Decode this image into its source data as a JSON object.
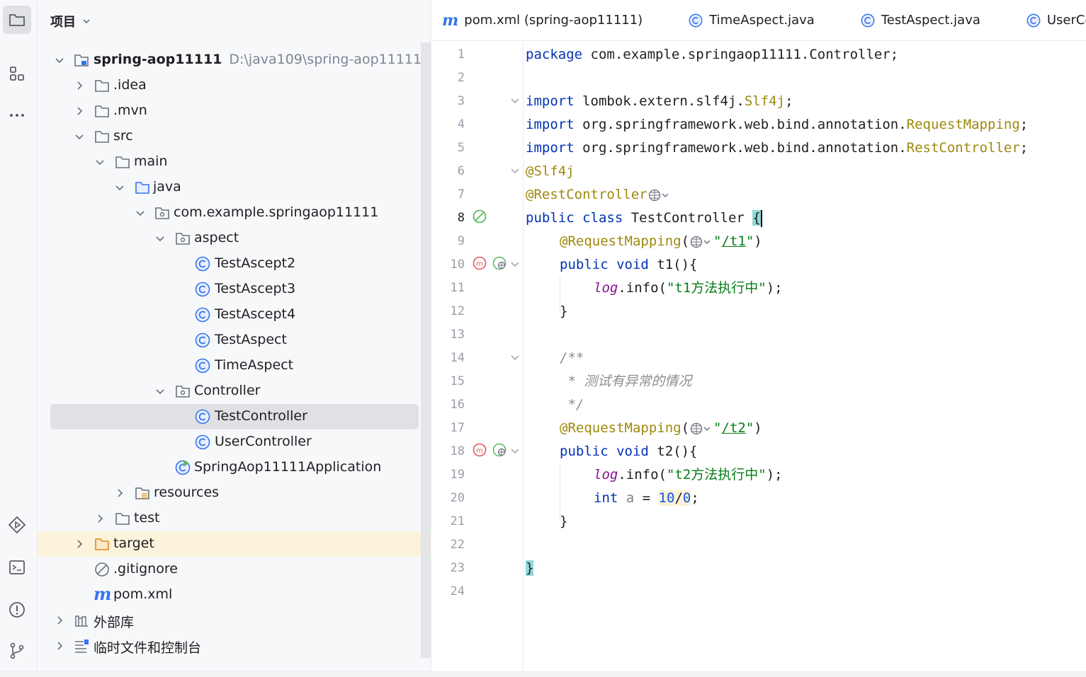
{
  "sidebar": {
    "tools": [
      "folder-icon",
      "structure-icon",
      "more-icon",
      "run-icon",
      "terminal-icon",
      "problems-icon",
      "git-icon"
    ]
  },
  "project": {
    "title": "项目",
    "tree": [
      {
        "label": "spring-aop11111",
        "path": "D:\\java109\\spring-aop11111",
        "type": "module",
        "expanded": true
      },
      {
        "label": ".idea",
        "type": "folder"
      },
      {
        "label": ".mvn",
        "type": "folder"
      },
      {
        "label": "src",
        "type": "folder",
        "expanded": true
      },
      {
        "label": "main",
        "type": "folder",
        "expanded": true
      },
      {
        "label": "java",
        "type": "source-folder",
        "expanded": true
      },
      {
        "label": "com.example.springaop11111",
        "type": "package",
        "expanded": true
      },
      {
        "label": "aspect",
        "type": "package",
        "expanded": true
      },
      {
        "label": "TestAscept2",
        "type": "class"
      },
      {
        "label": "TestAscept3",
        "type": "class"
      },
      {
        "label": "TestAscept4",
        "type": "class"
      },
      {
        "label": "TestAspect",
        "type": "class"
      },
      {
        "label": "TimeAspect",
        "type": "class"
      },
      {
        "label": "Controller",
        "type": "package",
        "expanded": true
      },
      {
        "label": "TestController",
        "type": "class",
        "selected": true
      },
      {
        "label": "UserController",
        "type": "class"
      },
      {
        "label": "SpringAop11111Application",
        "type": "app-class"
      },
      {
        "label": "resources",
        "type": "resources-folder"
      },
      {
        "label": "test",
        "type": "folder"
      },
      {
        "label": "target",
        "type": "excluded-folder"
      },
      {
        "label": ".gitignore",
        "type": "ignore-file"
      },
      {
        "label": "pom.xml",
        "type": "maven-file"
      },
      {
        "label": "外部库",
        "type": "libraries"
      },
      {
        "label": "临时文件和控制台",
        "type": "scratches"
      }
    ]
  },
  "tabs": [
    {
      "label": "pom.xml (spring-aop11111)",
      "icon": "maven-icon"
    },
    {
      "label": "TimeAspect.java",
      "icon": "class-icon"
    },
    {
      "label": "TestAspect.java",
      "icon": "class-icon"
    },
    {
      "label": "UserCont",
      "icon": "class-icon"
    }
  ],
  "editor": {
    "current_line": 8,
    "line_numbers": [
      "1",
      "2",
      "3",
      "4",
      "5",
      "6",
      "7",
      "8",
      "9",
      "10",
      "11",
      "12",
      "13",
      "14",
      "15",
      "16",
      "17",
      "18",
      "19",
      "20",
      "21",
      "22",
      "23",
      "24"
    ],
    "lines": {
      "l1_kw": "package",
      "l1_rest": " com.example.springaop11111.Controller;",
      "l3_kw": "import",
      "l3_rest": " lombok.extern.slf4j.",
      "l3_ann": "Slf4j",
      "l4_kw": "import",
      "l4_rest": " org.springframework.web.bind.annotation.",
      "l4_ann": "RequestMapping",
      "l5_kw": "import",
      "l5_rest": " org.springframework.web.bind.annotation.",
      "l5_ann": "RestController",
      "l6_ann": "@Slf4j",
      "l7_ann": "@RestController",
      "l8_kw": "public class",
      "l8_rest": " TestController ",
      "l8_brace": "{",
      "l9_ann": "@RequestMapping",
      "l9_path": "/t1",
      "l10_kw": "public void",
      "l10_rest": " t1(){",
      "l11_fld": "log",
      "l11_rest": ".info(",
      "l11_str": "\"t1方法执行中\"",
      "l11_end": ");",
      "l12": "}",
      "l14": "/**",
      "l15": " * 测试有异常的情况",
      "l16": " */",
      "l17_ann": "@RequestMapping",
      "l17_path": "/t2",
      "l18_kw": "public void",
      "l18_rest": " t2(){",
      "l19_fld": "log",
      "l19_rest": ".info(",
      "l19_str": "\"t2方法执行中\"",
      "l19_end": ");",
      "l20_kw": "int",
      "l20_var": " a",
      "l20_eq": " = ",
      "l20_n1": "10",
      "l20_slash": "/",
      "l20_n2": "0",
      "l20_end": ";",
      "l21": "}",
      "l23": "}"
    }
  },
  "colors": {
    "keyword": "#0033b3",
    "annotation": "#9e880d",
    "string": "#067d17",
    "number": "#1750eb",
    "comment": "#8c8c8c",
    "field": "#871094",
    "class_icon": "#3574f0",
    "selection": "#dfe1e5",
    "excluded_row": "#fcf3dc"
  }
}
